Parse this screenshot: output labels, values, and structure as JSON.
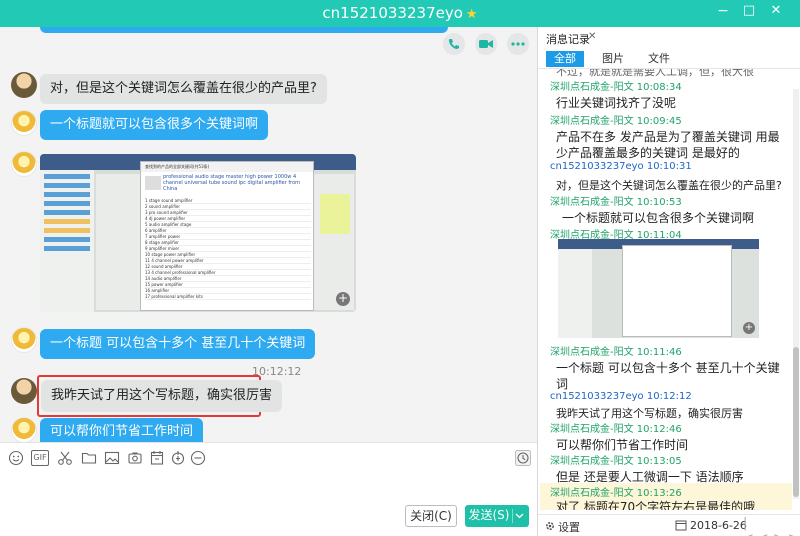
{
  "window": {
    "title": "cn1521033237eyo",
    "controls": [
      "−",
      "□",
      "✕"
    ]
  },
  "chat": {
    "messages": [
      {
        "side": "left",
        "text": "对，但是这个关键词怎么覆盖在很少的产品里?"
      },
      {
        "side": "right",
        "text": "一个标题就可以包含很多个关键词啊"
      },
      {
        "side": "right",
        "type": "image"
      },
      {
        "side": "right",
        "text": "一个标题 可以包含十多个 甚至几十个关键词"
      },
      {
        "side": "left",
        "time": "10:12:12",
        "text": "我昨天试了用这个写标题，确实很厉害"
      },
      {
        "side": "right",
        "text": "可以帮你们节省工作时间"
      }
    ],
    "screenshot": {
      "dialog_title": "查找到的产品的全部关键词(共53条)",
      "product_title": "professional audio stage master high power 1000w 4 channel universal tube sound ipc digital amplifier from China",
      "rows": [
        "stage sound amplifier",
        "sound amplifier",
        "pro sound amplifier",
        "dj power amplifier",
        "audio amplifier stage",
        "amplifier",
        "amplifier power",
        "stage amplifier",
        "amplifier mixer",
        "stage power amplifier",
        "4 channel power amplifier",
        "sound amplifier",
        "4 channel professional amplifier",
        "audio amplifier",
        "power amplifier",
        "amplifier",
        "professional amplifier kits"
      ]
    }
  },
  "toolbar": {
    "icons": [
      "emoji-icon",
      "gif-icon",
      "scissors-icon",
      "folder-icon",
      "image-icon",
      "screenshot-icon",
      "calendar-icon",
      "card-icon",
      "more-icon",
      "history-icon"
    ],
    "gif_label": "GIF"
  },
  "compose": {
    "close_label": "关闭(C)",
    "send_label": "发送(S)"
  },
  "history": {
    "title": "消息记录",
    "close": "✕",
    "tabs": [
      "全部",
      "图片",
      "文件"
    ],
    "partial_text": "不过，就是就是需要人工调，但，很大很",
    "entries": [
      {
        "sender": "深圳点石成金-阳文 10:08:34",
        "me": false,
        "lines": [
          "行业关键词找齐了没呢"
        ]
      },
      {
        "sender": "深圳点石成金-阳文 10:09:45",
        "me": false,
        "lines": [
          "产品不在多 发产品是为了覆盖关键词 用最",
          "少产品覆盖最多的关键词 是最好的"
        ]
      },
      {
        "sender": "cn1521033237eyo 10:10:31",
        "me": true,
        "lines": [
          "对，但是这个关键词怎么覆盖在很少的产品里?"
        ]
      },
      {
        "sender": "深圳点石成金-阳文 10:10:53",
        "me": false,
        "lines": [
          "一个标题就可以包含很多个关键词啊"
        ]
      },
      {
        "sender": "深圳点石成金-阳文 10:11:04",
        "me": false,
        "lines": []
      },
      {
        "sender": "深圳点石成金-阳文 10:11:46",
        "me": false,
        "lines": [
          "一个标题 可以包含十多个 甚至几十个关键",
          "词"
        ]
      },
      {
        "sender": "cn1521033237eyo 10:12:12",
        "me": true,
        "lines": [
          "我昨天试了用这个写标题，确实很厉害"
        ]
      },
      {
        "sender": "深圳点石成金-阳文 10:12:46",
        "me": false,
        "lines": [
          "可以帮你们节省工作时间"
        ]
      },
      {
        "sender": "深圳点石成金-阳文 10:13:05",
        "me": false,
        "lines": [
          "但是 还是要人工微调一下 语法顺序"
        ]
      },
      {
        "sender": "深圳点石成金-阳文 10:13:26",
        "me": false,
        "lines": [
          "对了 标题在70个字符左右是最佳的哦"
        ]
      }
    ],
    "footer": {
      "settings_label": "设置",
      "date": "2018-6-26"
    }
  },
  "colors": {
    "titlebar": "#22c9b4",
    "bubble_right": "#2eaaf0",
    "bubble_left": "#e2e3e3",
    "highlight_border": "#e53935",
    "send_button": "#1fc0a8"
  }
}
